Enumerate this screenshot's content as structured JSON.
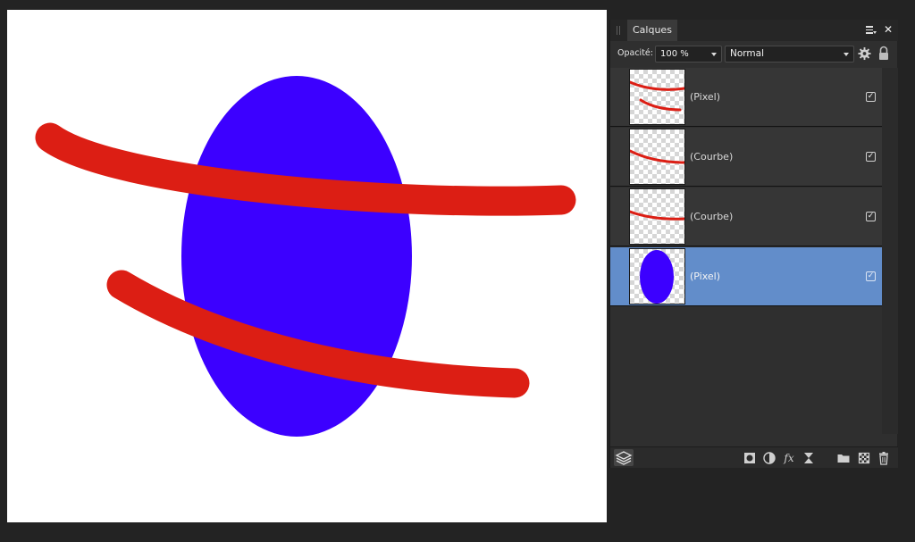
{
  "canvas": {
    "background": "#ffffff",
    "shapes": [
      {
        "kind": "ellipse",
        "color": "#3c00ff"
      },
      {
        "kind": "curve",
        "color": "#dc1e14"
      },
      {
        "kind": "curve",
        "color": "#dc1e14"
      }
    ]
  },
  "panel": {
    "tab_label": "Calques",
    "menu_icon": "panel-menu-icon",
    "close_icon": "close-icon",
    "opacity_label": "Opacité:",
    "opacity_value": "100 %",
    "blend_mode": "Normal",
    "settings_icon": "gear-icon",
    "lock_icon": "lock-icon"
  },
  "layers": [
    {
      "name": "(Pixel)",
      "thumbnail": "two-red-strokes",
      "visible": true,
      "selected": false
    },
    {
      "name": "(Courbe)",
      "thumbnail": "red-curve",
      "visible": true,
      "selected": false
    },
    {
      "name": "(Courbe)",
      "thumbnail": "red-curve",
      "visible": true,
      "selected": false
    },
    {
      "name": "(Pixel)",
      "thumbnail": "blue-ellipse",
      "visible": true,
      "selected": true
    }
  ],
  "bottom_toolbar": {
    "icons": [
      "layers-icon",
      "mask-icon",
      "adjustment-icon",
      "fx-icon",
      "live-filter-icon",
      "group-folder-icon",
      "add-pixel-layer-icon",
      "delete-icon"
    ],
    "fx_label": "fx"
  },
  "colors": {
    "selection": "#628dca",
    "panel": "#2f2f2f",
    "stroke_red": "#dc1e14",
    "ellipse_blue": "#3c00ff"
  }
}
